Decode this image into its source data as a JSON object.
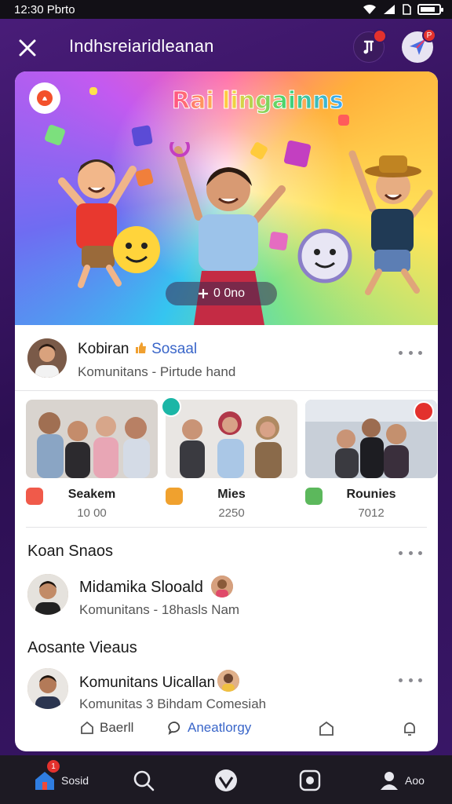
{
  "status_bar": {
    "time": "12:30 Pbrto"
  },
  "header": {
    "title": "Indhsreiaridleanan",
    "music_badge": "",
    "send_badge": "P"
  },
  "hero": {
    "title": "Rai lingainns",
    "pill_text": "0 0no",
    "pill_icon": "plus-icon"
  },
  "featured": {
    "name": "Kobiran",
    "tag": "Sosaal",
    "subtitle": "Komunitans - Pirtude hand"
  },
  "photo_cards": [
    {
      "name": "Seakem",
      "count": "10 00"
    },
    {
      "name": "Mies",
      "count": "2250"
    },
    {
      "name": "Rounies",
      "count": "7012"
    }
  ],
  "section1": {
    "title": "Koan Snaos"
  },
  "person1": {
    "name": "Midamika Slooald",
    "subtitle": "Komunitans - 18hasls Nam"
  },
  "section2": {
    "title": "Aosante Vieaus"
  },
  "person2": {
    "name": "Komunitans Uicallan",
    "subtitle": "Komunitas 3 Bihdam Comesiah"
  },
  "actions": {
    "share": "Baerll",
    "comment": "Aneatlorgy"
  },
  "bottom_nav": {
    "home": "Sosid",
    "home_badge": "1",
    "profile": "Aoo"
  },
  "colors": {
    "accent": "#e3312d",
    "background": "#3a1768",
    "nav": "#1d1a23"
  }
}
